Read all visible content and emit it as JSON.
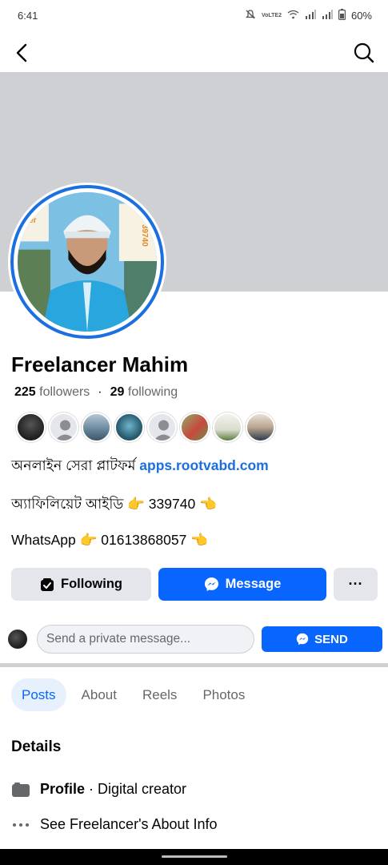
{
  "status_bar": {
    "time": "6:41",
    "network_label": "VoLTE2",
    "battery": "60%"
  },
  "nav": {
    "back_icon": "chevron-left-icon",
    "search_icon": "search-icon"
  },
  "profile": {
    "name": "Freelancer Mahim",
    "followers_count": "225",
    "followers_label": "followers",
    "following_count": "29",
    "following_label": "following",
    "photo_text_left": "der",
    "photo_text_right": "39740"
  },
  "bio": {
    "line1_text": "অনলাইন সেরা প্লাটফর্ম ",
    "line1_link": "apps.rootvabd.com",
    "line2": "অ্যাফিলিয়েট আইডি 👉 339740 👈",
    "line3": "WhatsApp 👉 01613868057 👈"
  },
  "buttons": {
    "following": "Following",
    "message": "Message",
    "more": "···"
  },
  "private_message": {
    "placeholder": "Send a private message...",
    "send": "SEND"
  },
  "tabs": [
    {
      "label": "Posts",
      "active": true
    },
    {
      "label": "About",
      "active": false
    },
    {
      "label": "Reels",
      "active": false
    },
    {
      "label": "Photos",
      "active": false
    }
  ],
  "details": {
    "heading": "Details",
    "profile_bold": "Profile",
    "profile_rest": " · Digital creator",
    "about_link": "See Freelancer's About Info"
  },
  "colors": {
    "accent": "#0866ff",
    "avatar_ring": "#1b6fe0",
    "cover": "#ced0d4"
  }
}
